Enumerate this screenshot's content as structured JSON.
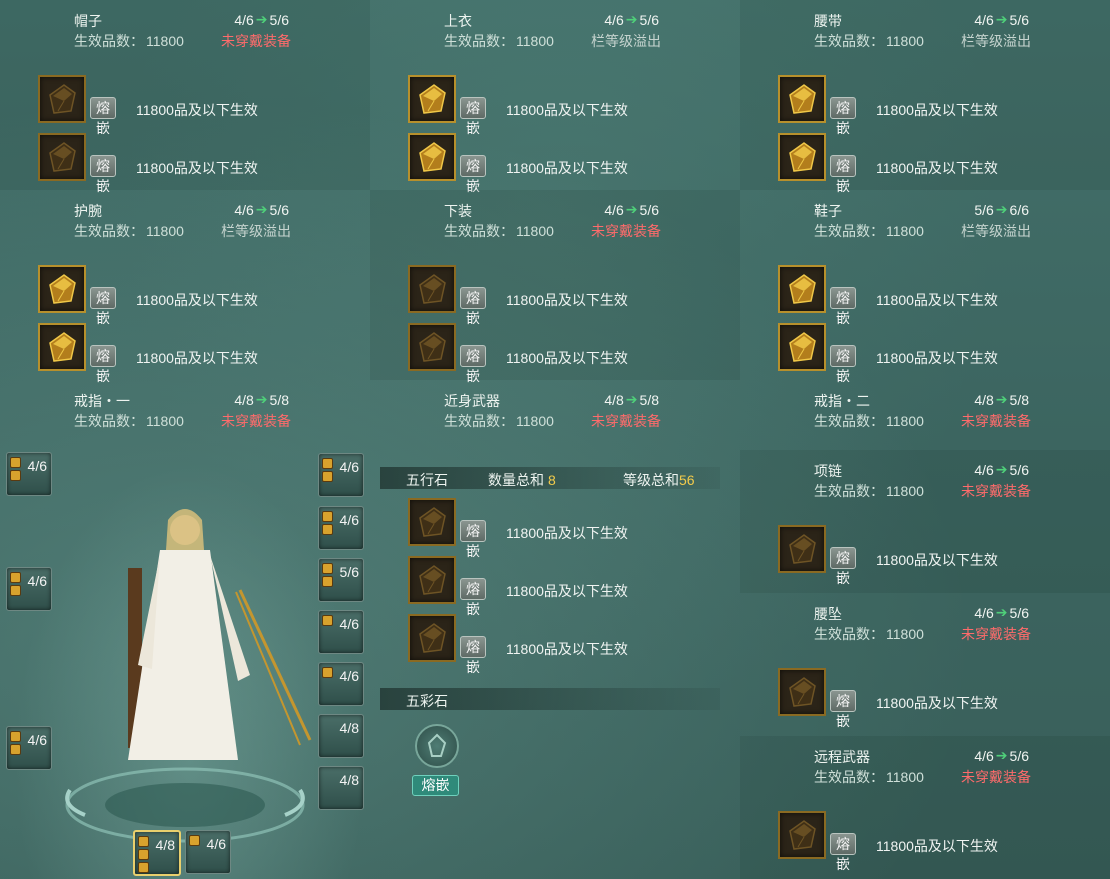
{
  "top_panels": [
    {
      "name": "帽子",
      "from": "4/6",
      "to": "5/6",
      "eff_label": "生效品数：",
      "eff_value": "11800",
      "status": "未穿戴装备",
      "status_type": "red",
      "gems": [
        {
          "text": "11800品及以下生效",
          "active": false
        },
        {
          "text": "11800品及以下生效",
          "active": false
        }
      ]
    },
    {
      "name": "上衣",
      "from": "4/6",
      "to": "5/6",
      "eff_label": "生效品数：",
      "eff_value": "11800",
      "status": "栏等级溢出",
      "status_type": "grey",
      "gems": [
        {
          "text": "11800品及以下生效",
          "active": true
        },
        {
          "text": "11800品及以下生效",
          "active": true
        }
      ]
    },
    {
      "name": "腰带",
      "from": "4/6",
      "to": "5/6",
      "eff_label": "生效品数：",
      "eff_value": "11800",
      "status": "栏等级溢出",
      "status_type": "grey",
      "gems": [
        {
          "text": "11800品及以下生效",
          "active": true
        },
        {
          "text": "11800品及以下生效",
          "active": true
        }
      ]
    },
    {
      "name": "护腕",
      "from": "4/6",
      "to": "5/6",
      "eff_label": "生效品数：",
      "eff_value": "11800",
      "status": "栏等级溢出",
      "status_type": "grey",
      "gems": [
        {
          "text": "11800品及以下生效",
          "active": true
        },
        {
          "text": "11800品及以下生效",
          "active": true
        }
      ]
    },
    {
      "name": "下装",
      "from": "4/6",
      "to": "5/6",
      "eff_label": "生效品数：",
      "eff_value": "11800",
      "status": "未穿戴装备",
      "status_type": "red",
      "gems": [
        {
          "text": "11800品及以下生效",
          "active": false
        },
        {
          "text": "11800品及以下生效",
          "active": false
        }
      ]
    },
    {
      "name": "鞋子",
      "from": "5/6",
      "to": "6/6",
      "eff_label": "生效品数：",
      "eff_value": "11800",
      "status": "栏等级溢出",
      "status_type": "grey",
      "gems": [
        {
          "text": "11800品及以下生效",
          "active": true
        },
        {
          "text": "11800品及以下生效",
          "active": true
        }
      ]
    }
  ],
  "row3_panels": [
    {
      "name": "戒指・一",
      "from": "4/8",
      "to": "5/8",
      "eff_label": "生效品数：",
      "eff_value": "11800",
      "status": "未穿戴装备",
      "status_type": "red"
    },
    {
      "name": "近身武器",
      "from": "4/8",
      "to": "5/8",
      "eff_label": "生效品数：",
      "eff_value": "11800",
      "status": "未穿戴装备",
      "status_type": "red"
    },
    {
      "name": "戒指・二",
      "from": "4/8",
      "to": "5/8",
      "eff_label": "生效品数：",
      "eff_value": "11800",
      "status": "未穿戴装备",
      "status_type": "red"
    }
  ],
  "right_panels": [
    {
      "name": "项链",
      "from": "4/6",
      "to": "5/6",
      "eff_label": "生效品数：",
      "eff_value": "11800",
      "status": "未穿戴装备",
      "status_type": "red",
      "gems": [
        {
          "text": "11800品及以下生效",
          "active": false
        }
      ]
    },
    {
      "name": "腰坠",
      "from": "4/6",
      "to": "5/6",
      "eff_label": "生效品数：",
      "eff_value": "11800",
      "status": "未穿戴装备",
      "status_type": "red",
      "gems": [
        {
          "text": "11800品及以下生效",
          "active": false
        }
      ]
    },
    {
      "name": "远程武器",
      "from": "4/6",
      "to": "5/6",
      "eff_label": "生效品数：",
      "eff_value": "11800",
      "status": "未穿戴装备",
      "status_type": "red",
      "gems": [
        {
          "text": "11800品及以下生效",
          "active": false
        }
      ]
    }
  ],
  "inlay_label": "熔嵌",
  "wuxing": {
    "title": "五行石",
    "count_label": "数量总和",
    "count_value": "8",
    "level_label": "等级总和",
    "level_value": "56",
    "gems": [
      "11800品及以下生效",
      "11800品及以下生效",
      "11800品及以下生效"
    ]
  },
  "wucai": {
    "title": "五彩石",
    "button": "熔嵌"
  },
  "char_slots_left": [
    {
      "value": "4/6",
      "dots": 2
    },
    {
      "value": "4/6",
      "dots": 2
    },
    {
      "value": "4/6",
      "dots": 2
    }
  ],
  "char_slots_right": [
    {
      "value": "4/6",
      "dots": 2
    },
    {
      "value": "4/6",
      "dots": 2
    },
    {
      "value": "5/6",
      "dots": 2
    },
    {
      "value": "4/6",
      "dots": 1
    },
    {
      "value": "4/6",
      "dots": 1
    },
    {
      "value": "4/8",
      "dots": 0
    },
    {
      "value": "4/8",
      "dots": 0
    }
  ],
  "char_slots_bottom": [
    {
      "value": "4/8",
      "dots": 3,
      "selected": true
    },
    {
      "value": "4/6",
      "dots": 1
    }
  ],
  "colors": {
    "accent_green": "#4fd07a",
    "warn_red": "#ff6b6b",
    "level_yellow": "#f3cb4b",
    "gem_border": "#b7902c"
  }
}
